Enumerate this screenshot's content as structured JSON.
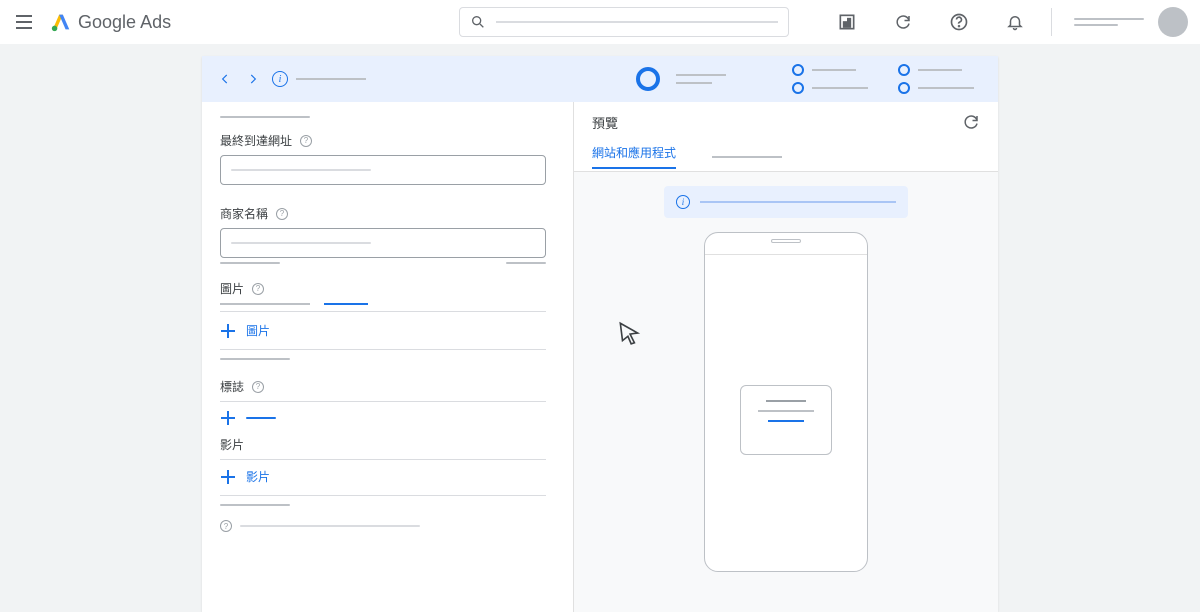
{
  "brand": {
    "google": "Google",
    "ads": "Ads"
  },
  "form": {
    "final_url_label": "最終到達網址",
    "business_name_label": "商家名稱",
    "images_label": "圖片",
    "add_image_label": "圖片",
    "logos_label": "標誌",
    "videos_label": "影片",
    "add_video_label": "影片"
  },
  "preview": {
    "title": "預覽",
    "tab_active": "網站和應用程式"
  }
}
